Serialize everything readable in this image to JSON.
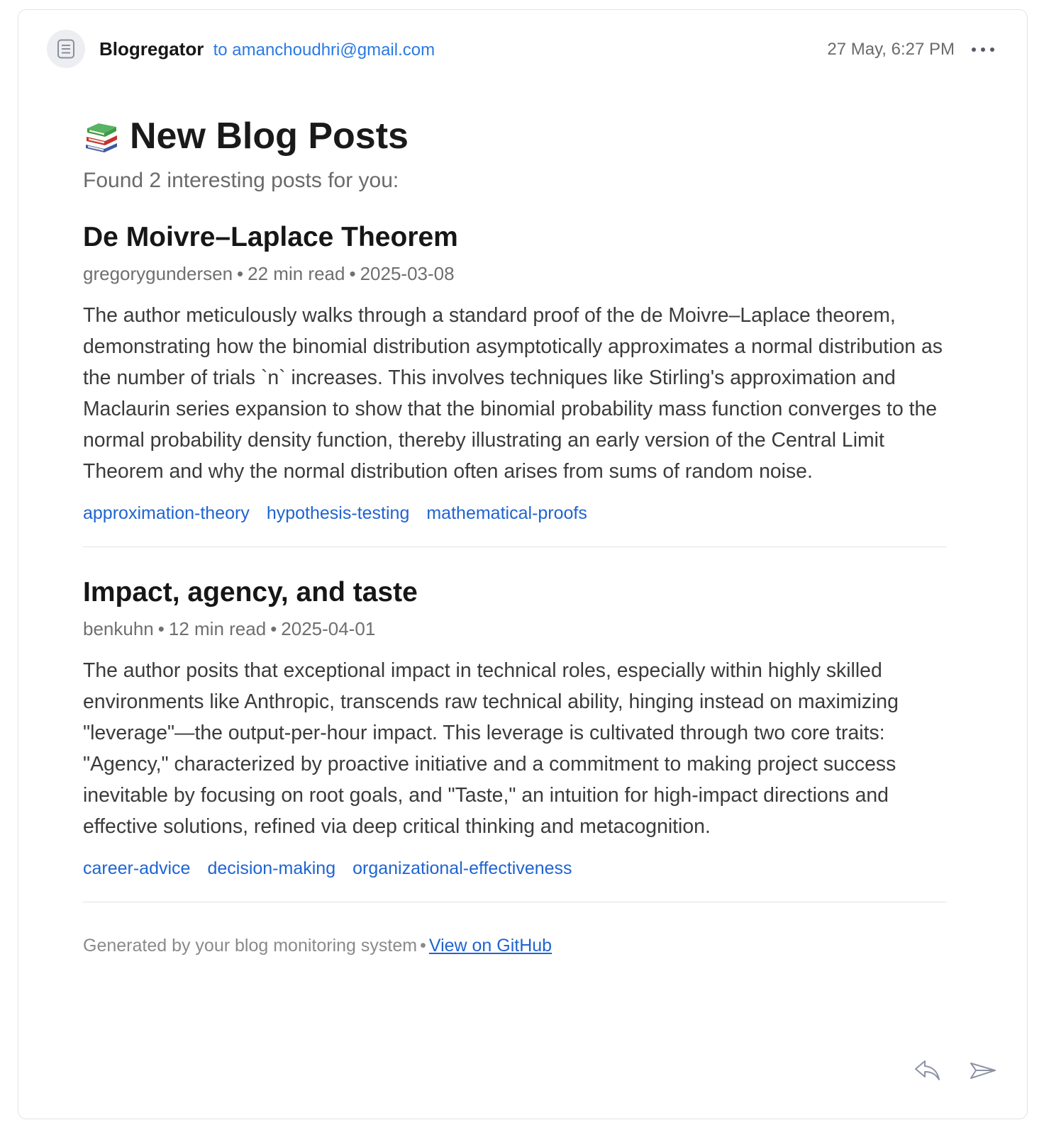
{
  "email": {
    "sender_name": "Blogregator",
    "to_line": "to amanchoudhri@gmail.com",
    "timestamp": "27 May, 6:27 PM"
  },
  "icons": {
    "avatar": "document-icon",
    "more": "more-horizontal-icon",
    "title_emoji": "books-icon",
    "reply": "reply-icon",
    "forward": "forward-icon"
  },
  "body": {
    "title": "New Blog Posts",
    "intro": "Found 2 interesting posts for you:",
    "posts": [
      {
        "title": "De Moivre–Laplace Theorem",
        "author": "gregorygundersen",
        "read_time": "22 min read",
        "date": "2025-03-08",
        "summary": "The author meticulously walks through a standard proof of the de Moivre–Laplace theorem, demonstrating how the binomial distribution asymptotically approximates a normal distribution as the number of trials `n` increases. This involves techniques like Stirling's approximation and Maclaurin series expansion to show that the binomial probability mass function converges to the normal probability density function, thereby illustrating an early version of the Central Limit Theorem and why the normal distribution often arises from sums of random noise.",
        "tags": [
          "approximation-theory",
          "hypothesis-testing",
          "mathematical-proofs"
        ]
      },
      {
        "title": "Impact, agency, and taste",
        "author": "benkuhn",
        "read_time": "12 min read",
        "date": "2025-04-01",
        "summary": "The author posits that exceptional impact in technical roles, especially within highly skilled environments like Anthropic, transcends raw technical ability, hinging instead on maximizing \"leverage\"—the output-per-hour impact. This leverage is cultivated through two core traits: \"Agency,\" characterized by proactive initiative and a commitment to making project success inevitable by focusing on root goals, and \"Taste,\" an intuition for high-impact directions and effective solutions, refined via deep critical thinking and metacognition.",
        "tags": [
          "career-advice",
          "decision-making",
          "organizational-effectiveness"
        ]
      }
    ],
    "footer_text": "Generated by your blog monitoring system",
    "footer_sep": "•",
    "footer_link": "View on GitHub"
  },
  "meta_sep": "•",
  "colors": {
    "link": "#1f64d2",
    "to_line": "#2a7ae4",
    "muted": "#6f6f6f",
    "divider": "#e2e2e2"
  }
}
